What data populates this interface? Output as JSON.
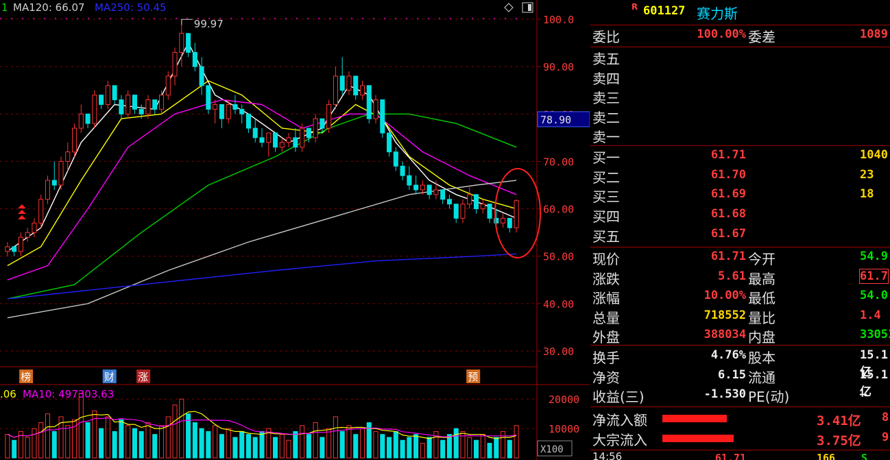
{
  "legend": {
    "ma_top_prefix": "1",
    "ma120": "MA120: 66.07",
    "ma250": "MA250: 50.45",
    "vol_prefix": ".06",
    "vol_ma10": "MA10: 497303.63"
  },
  "price_axis": [
    "100.0",
    "90.00",
    "80.00",
    "70.00",
    "60.00",
    "50.00",
    "40.00",
    "30.00"
  ],
  "volume_axis": [
    "20000",
    "10000"
  ],
  "axis_unit": "X100",
  "highlight_price": "78.90",
  "high_marker": "99.97",
  "event_tags": [
    {
      "text": "榜",
      "pos": 0.037,
      "color": "#d2691e"
    },
    {
      "text": "财",
      "pos": 0.197,
      "color": "#3a7ad0"
    },
    {
      "text": "涨",
      "pos": 0.262,
      "color": "#b02020"
    },
    {
      "text": "预",
      "pos": 0.895,
      "color": "#d2691e"
    }
  ],
  "colors": {
    "ma5": "#ffffff",
    "ma10": "#ffff00",
    "ma20": "#ff00ff",
    "ma60": "#00d000",
    "ma120": "#c8c8c8",
    "ma250": "#2020ff",
    "up": "#ff3232",
    "down": "#00e0e0",
    "grid": "#8b0000",
    "axis": "#a00000"
  },
  "chart_data": {
    "type": "candlestick",
    "y_range": [
      25,
      103
    ],
    "vol_range": [
      0,
      24000
    ],
    "candles": [
      [
        51,
        53,
        50,
        52
      ],
      [
        52,
        51,
        50,
        51
      ],
      [
        51,
        55,
        50,
        54
      ],
      [
        54,
        56,
        53,
        55
      ],
      [
        55,
        58,
        54,
        57
      ],
      [
        57,
        63,
        56,
        62
      ],
      [
        62,
        67,
        61,
        66
      ],
      [
        66,
        70,
        64,
        65
      ],
      [
        65,
        71,
        64,
        70
      ],
      [
        70,
        74,
        68,
        72
      ],
      [
        72,
        78,
        71,
        77
      ],
      [
        77,
        82,
        76,
        80
      ],
      [
        80,
        79,
        77,
        78
      ],
      [
        78,
        85,
        77,
        84
      ],
      [
        84,
        83,
        81,
        82
      ],
      [
        82,
        87,
        81,
        86
      ],
      [
        86,
        85,
        82,
        83
      ],
      [
        83,
        84,
        79,
        80
      ],
      [
        80,
        85,
        79,
        84
      ],
      [
        84,
        83,
        80,
        81
      ],
      [
        81,
        82,
        79,
        80
      ],
      [
        80,
        84,
        79,
        83
      ],
      [
        83,
        82,
        80,
        81
      ],
      [
        81,
        85,
        80,
        84
      ],
      [
        84,
        89,
        83,
        88
      ],
      [
        88,
        94,
        86,
        93
      ],
      [
        93,
        100,
        90,
        97
      ],
      [
        97,
        96,
        92,
        93
      ],
      [
        93,
        95,
        89,
        90
      ],
      [
        90,
        92,
        84,
        86
      ],
      [
        86,
        85,
        80,
        81
      ],
      [
        81,
        83,
        78,
        82
      ],
      [
        82,
        81,
        77,
        79
      ],
      [
        79,
        83,
        78,
        82
      ],
      [
        82,
        84,
        80,
        81
      ],
      [
        81,
        82,
        78,
        80
      ],
      [
        80,
        79,
        76,
        77
      ],
      [
        77,
        79,
        74,
        75
      ],
      [
        75,
        77,
        73,
        74
      ],
      [
        74,
        76,
        71,
        76
      ],
      [
        76,
        75,
        72,
        73
      ],
      [
        73,
        75,
        72,
        74
      ],
      [
        74,
        76,
        73,
        75
      ],
      [
        75,
        77,
        72,
        73
      ],
      [
        73,
        78,
        72,
        77
      ],
      [
        77,
        76,
        74,
        75
      ],
      [
        75,
        80,
        74,
        79
      ],
      [
        79,
        78,
        76,
        77
      ],
      [
        77,
        83,
        76,
        82
      ],
      [
        82,
        90,
        81,
        88
      ],
      [
        88,
        92,
        84,
        85
      ],
      [
        85,
        89,
        84,
        88
      ],
      [
        88,
        87,
        83,
        84
      ],
      [
        84,
        87,
        83,
        86
      ],
      [
        86,
        85,
        78,
        79
      ],
      [
        79,
        84,
        78,
        83
      ],
      [
        83,
        82,
        75,
        76
      ],
      [
        76,
        74,
        71,
        72
      ],
      [
        72,
        73,
        68,
        69
      ],
      [
        69,
        70,
        66,
        67
      ],
      [
        67,
        69,
        64,
        65
      ],
      [
        65,
        67,
        63,
        64
      ],
      [
        64,
        66,
        63,
        65
      ],
      [
        65,
        64,
        62,
        63
      ],
      [
        63,
        66,
        62,
        64
      ],
      [
        64,
        63,
        61,
        62
      ],
      [
        62,
        63,
        60,
        61
      ],
      [
        61,
        60,
        57,
        58
      ],
      [
        58,
        62,
        57,
        61
      ],
      [
        61,
        65,
        60,
        63
      ],
      [
        63,
        62,
        59,
        60
      ],
      [
        60,
        62,
        59,
        61
      ],
      [
        61,
        59,
        57,
        58
      ],
      [
        58,
        60,
        56,
        57
      ],
      [
        57,
        59,
        56,
        58
      ],
      [
        58,
        57,
        55,
        56
      ],
      [
        56,
        62,
        55,
        61.71
      ]
    ],
    "volumes": [
      8,
      6,
      9,
      7,
      10,
      12,
      15,
      9,
      14,
      11,
      13,
      22,
      12,
      16,
      10,
      14,
      9,
      13,
      11,
      10,
      9,
      12,
      8,
      11,
      14,
      18,
      20,
      15,
      12,
      10,
      9,
      11,
      8,
      10,
      7,
      9,
      8,
      7,
      9,
      10,
      7,
      8,
      6,
      9,
      11,
      8,
      12,
      7,
      10,
      14,
      9,
      11,
      8,
      10,
      12,
      9,
      8,
      7,
      9,
      6,
      7,
      8,
      5,
      7,
      9,
      6,
      8,
      10,
      9,
      7,
      6,
      8,
      5,
      7,
      9,
      6,
      11
    ],
    "ma_lines": {
      "ma5": [
        [
          0,
          51
        ],
        [
          5,
          56
        ],
        [
          11,
          74
        ],
        [
          16,
          82
        ],
        [
          22,
          81
        ],
        [
          27,
          95
        ],
        [
          31,
          84
        ],
        [
          36,
          80
        ],
        [
          42,
          74
        ],
        [
          47,
          77
        ],
        [
          51,
          86
        ],
        [
          54,
          84
        ],
        [
          58,
          74
        ],
        [
          63,
          66
        ],
        [
          67,
          63
        ],
        [
          71,
          61
        ],
        [
          76,
          58
        ]
      ],
      "ma10": [
        [
          0,
          48
        ],
        [
          5,
          52
        ],
        [
          11,
          66
        ],
        [
          17,
          79
        ],
        [
          23,
          80
        ],
        [
          30,
          87
        ],
        [
          35,
          84
        ],
        [
          41,
          77
        ],
        [
          47,
          76
        ],
        [
          52,
          82
        ],
        [
          56,
          79
        ],
        [
          60,
          71
        ],
        [
          66,
          65
        ],
        [
          71,
          62
        ],
        [
          76,
          60
        ]
      ],
      "ma20": [
        [
          0,
          45
        ],
        [
          6,
          48
        ],
        [
          12,
          60
        ],
        [
          18,
          73
        ],
        [
          25,
          80
        ],
        [
          32,
          83
        ],
        [
          38,
          82
        ],
        [
          44,
          77
        ],
        [
          51,
          80
        ],
        [
          55,
          80
        ],
        [
          62,
          72
        ],
        [
          69,
          67
        ],
        [
          76,
          63
        ]
      ],
      "ma60": [
        [
          0,
          41
        ],
        [
          10,
          44
        ],
        [
          20,
          55
        ],
        [
          30,
          65
        ],
        [
          40,
          71
        ],
        [
          48,
          77
        ],
        [
          54,
          80
        ],
        [
          60,
          80
        ],
        [
          67,
          78
        ],
        [
          76,
          73
        ]
      ],
      "ma120": [
        [
          0,
          37
        ],
        [
          12,
          40
        ],
        [
          24,
          47
        ],
        [
          36,
          53
        ],
        [
          48,
          58
        ],
        [
          60,
          63
        ],
        [
          70,
          65
        ],
        [
          76,
          66
        ]
      ],
      "ma250": [
        [
          0,
          41
        ],
        [
          20,
          44
        ],
        [
          40,
          47
        ],
        [
          55,
          49
        ],
        [
          70,
          50
        ],
        [
          76,
          50.5
        ]
      ]
    },
    "ylabel": "",
    "xlabel": ""
  },
  "quote": {
    "market_tag": "R",
    "code": "601127",
    "name": "赛力斯",
    "weibi_label": "委比",
    "weibi_value": "100.00%",
    "weicha_label": "委差",
    "weicha_value": "1089",
    "asks": [
      {
        "label": "卖五"
      },
      {
        "label": "卖四"
      },
      {
        "label": "卖三"
      },
      {
        "label": "卖二"
      },
      {
        "label": "卖一"
      }
    ],
    "bids": [
      {
        "label": "买一",
        "price": "61.71",
        "vol": "1040"
      },
      {
        "label": "买二",
        "price": "61.70",
        "vol": "23"
      },
      {
        "label": "买三",
        "price": "61.69",
        "vol": "18"
      },
      {
        "label": "买四",
        "price": "61.68",
        "vol": ""
      },
      {
        "label": "买五",
        "price": "61.67",
        "vol": ""
      }
    ],
    "stats": [
      {
        "l1": "现价",
        "v1": "61.71",
        "c1": "red",
        "l2": "今开",
        "v2": "54.9",
        "c2": "grn",
        "box": false
      },
      {
        "l1": "涨跌",
        "v1": "5.61",
        "c1": "red",
        "l2": "最高",
        "v2": "61.7",
        "c2": "red",
        "box": true
      },
      {
        "l1": "涨幅",
        "v1": "10.00%",
        "c1": "red",
        "l2": "最低",
        "v2": "54.0",
        "c2": "grn",
        "box": false
      },
      {
        "l1": "总量",
        "v1": "718552",
        "c1": "yel",
        "l2": "量比",
        "v2": "1.4",
        "c2": "red",
        "box": false
      },
      {
        "l1": "外盘",
        "v1": "388034",
        "c1": "red",
        "l2": "内盘",
        "v2": "33051",
        "c2": "grn",
        "box": false
      }
    ],
    "fin": [
      {
        "l1": "换手",
        "v1": "4.76%",
        "l2": "股本",
        "v2": "15.1亿"
      },
      {
        "l1": "净资",
        "v1": "6.15",
        "l2": "流通",
        "v2": "15.1亿"
      },
      {
        "l1": "收益(三)",
        "v1": "-1.530",
        "l2": "PE(动)",
        "v2": "—"
      }
    ],
    "flows": [
      {
        "label": "净流入额",
        "value": "3.41亿",
        "extra": "8",
        "bar": 0.72
      },
      {
        "label": "大宗流入",
        "value": "3.75亿",
        "extra": "9",
        "bar": 0.8
      }
    ],
    "tick": {
      "time": "14:56",
      "price": "61.71",
      "vol": "166",
      "flag": "S"
    }
  }
}
